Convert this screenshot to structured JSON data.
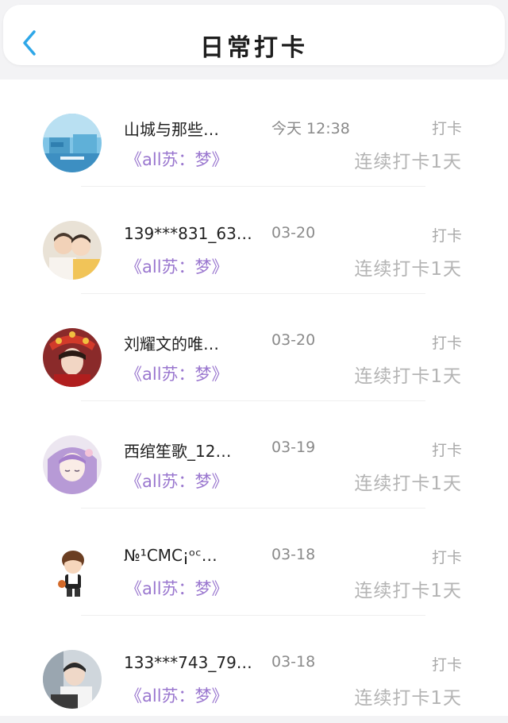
{
  "header": {
    "title": "日常打卡",
    "back_icon": "chevron-left-icon",
    "accent_color": "#2ea7e8"
  },
  "checkins": [
    {
      "name": "山城与那些…",
      "time": "今天 12:38",
      "status": "打卡",
      "group": "《all苏：梦》",
      "streak": "连续打卡1天",
      "avatar": "avatar-blue-scene"
    },
    {
      "name": "139***831_63…",
      "time": "03-20",
      "status": "打卡",
      "group": "《all苏：梦》",
      "streak": "连续打卡1天",
      "avatar": "avatar-two-people"
    },
    {
      "name": "刘耀文的唯…",
      "time": "03-20",
      "status": "打卡",
      "group": "《all苏：梦》",
      "streak": "连续打卡1天",
      "avatar": "avatar-headdress"
    },
    {
      "name": "西绾笙歌_12…",
      "time": "03-19",
      "status": "打卡",
      "group": "《all苏：梦》",
      "streak": "连续打卡1天",
      "avatar": "avatar-purple-hair"
    },
    {
      "name": "№¹CMC¡ᵒᶜ…",
      "time": "03-18",
      "status": "打卡",
      "group": "《all苏：梦》",
      "streak": "连续打卡1天",
      "avatar": "avatar-cartoon-boy"
    },
    {
      "name": "133***743_79…",
      "time": "03-18",
      "status": "打卡",
      "group": "《all苏：梦》",
      "streak": "连续打卡1天",
      "avatar": "avatar-photo-gray"
    }
  ]
}
